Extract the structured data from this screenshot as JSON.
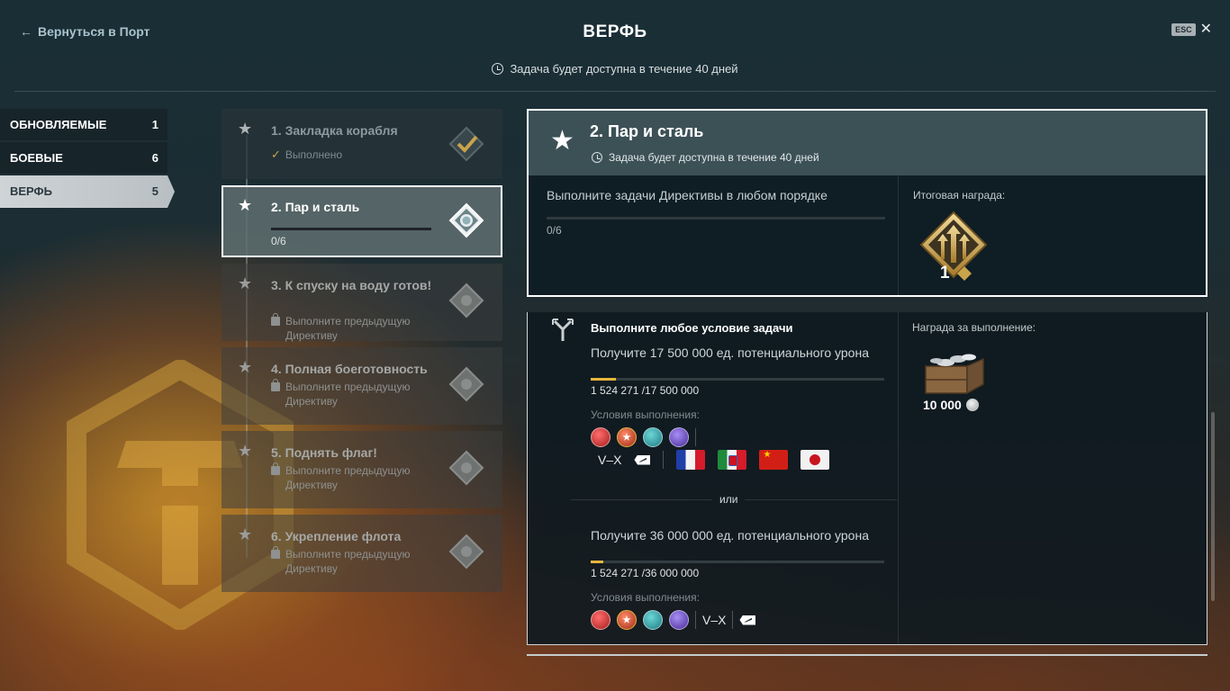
{
  "header": {
    "back_label": "Вернуться в Порт",
    "title": "ВЕРФЬ",
    "esc_label": "ESC",
    "timer_text": "Задача будет доступна в течение 40 дней"
  },
  "categories": [
    {
      "label": "ОБНОВЛЯЕМЫЕ",
      "count": "1"
    },
    {
      "label": "БОЕВЫЕ",
      "count": "6"
    },
    {
      "label": "ВЕРФЬ",
      "count": "5"
    }
  ],
  "directives": [
    {
      "title": "1. Закладка корабля",
      "status": "Выполнено"
    },
    {
      "title": "2. Пар и сталь",
      "progress": "0/6"
    },
    {
      "title": "3. К спуску на воду готов!",
      "status": "Выполните предыдущую Директиву"
    },
    {
      "title": "4. Полная боеготовность",
      "status": "Выполните предыдущую Директиву"
    },
    {
      "title": "5. Поднять флаг!",
      "status": "Выполните предыдущую Директиву"
    },
    {
      "title": "6. Укрепление флота",
      "status": "Выполните предыдущую Директиву"
    }
  ],
  "main": {
    "title": "2. Пар и сталь",
    "timer_text": "Задача будет доступна в течение 40 дней",
    "task_text": "Выполните задачи Директивы в любом порядке",
    "progress": "0/6",
    "progress_value": 0,
    "final_reward_label": "Итоговая награда:",
    "final_reward_count": "1",
    "heading": "Выполните любое условие задачи",
    "conditions": [
      {
        "text": "Получите 17 500 000 ед. потенциального урона",
        "count": "1 524 271 /17 500 000",
        "fraction": 0.087,
        "label": "Условия выполнения:",
        "tier": "V–X"
      },
      {
        "text": "Получите 36 000 000 ед. потенциального урона",
        "count": "1 524 271 /36 000 000",
        "fraction": 0.042,
        "label": "Условия выполнения:",
        "tier": "V–X"
      }
    ],
    "or_label": "или",
    "complete_reward_label": "Награда за выполнение:",
    "complete_reward_count": "10 000",
    "ship_types": [
      "destroyer-icon",
      "cruiser-icon",
      "battleship-icon",
      "carrier-icon"
    ],
    "nations": [
      "flag-france",
      "flag-italy",
      "flag-china",
      "flag-japan"
    ]
  },
  "colors": {
    "accent": "#e7b53c",
    "panel_header": "#3c5156"
  }
}
